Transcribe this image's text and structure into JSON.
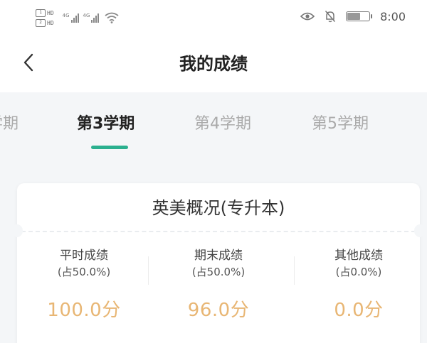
{
  "status_bar": {
    "sim1_tag": "HD",
    "sim2_tag": "HD",
    "signal1_label": "4G",
    "signal2_label": "4G",
    "time": "8:00"
  },
  "header": {
    "title": "我的成绩"
  },
  "tabs": {
    "items": [
      {
        "label": "学期"
      },
      {
        "label": "第3学期"
      },
      {
        "label": "第4学期"
      },
      {
        "label": "第5学期"
      }
    ],
    "active_index": 1,
    "accent_color": "#2bb08f"
  },
  "course": {
    "title": "英美概况(专升本)",
    "scores": [
      {
        "label": "平时成绩",
        "weight": "(占50.0%)",
        "value": "100.0分"
      },
      {
        "label": "期末成绩",
        "weight": "(占50.0%)",
        "value": "96.0分"
      },
      {
        "label": "其他成绩",
        "weight": "(占0.0%)",
        "value": "0.0分"
      }
    ],
    "value_color": "#e8b674"
  }
}
